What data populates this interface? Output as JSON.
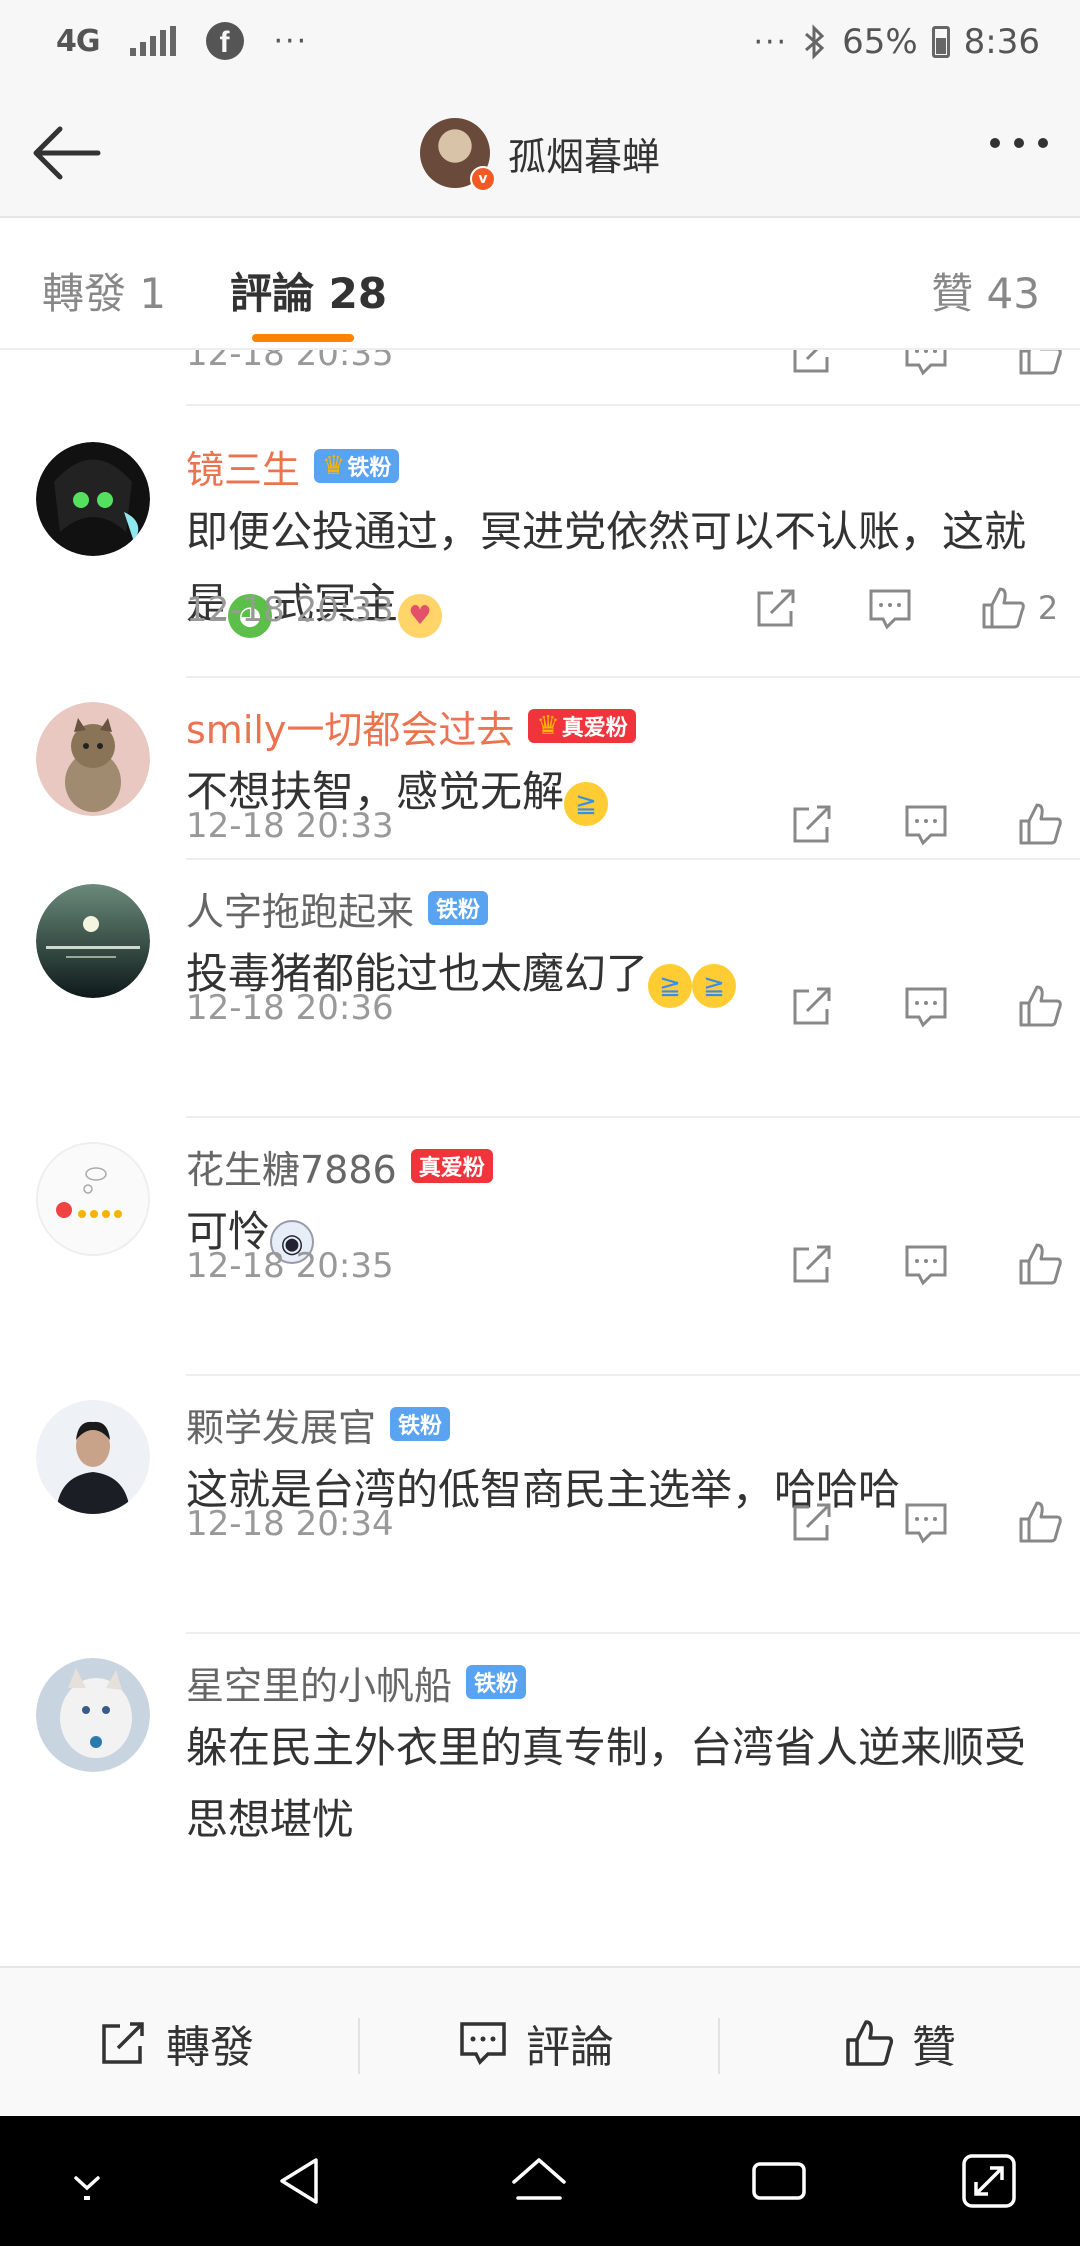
{
  "status_bar": {
    "network": "4G",
    "battery": "65%",
    "time": "8:36",
    "overflow": "···"
  },
  "header": {
    "title": "孤烟暮蝉"
  },
  "tabs": [
    {
      "label": "轉發 1",
      "active": false
    },
    {
      "label": "評論 28",
      "active": true
    },
    {
      "label": "贊 43",
      "active": false
    }
  ],
  "partial_comment": {
    "time": "12-18 20:35"
  },
  "comments": [
    {
      "username": "镜三生",
      "name_color": "orange",
      "badge": "铁粉",
      "badge_color": "blue",
      "crown": true,
      "text_segments": [
        "即便公投通过，冥进党依然可以不认账，这就是",
        "式冥主"
      ],
      "emojis": [
        "frog-emoji",
        "cat-hearts-emoji"
      ],
      "time": "12-18 20:33",
      "likes": "2"
    },
    {
      "username": "smily一切都会过去",
      "name_color": "orange",
      "badge": "真爱粉",
      "badge_color": "red",
      "crown": true,
      "text_segments": [
        "不想扶智，感觉无解"
      ],
      "emojis": [
        "laugh-cry-emoji"
      ],
      "time": "12-18 20:33",
      "likes": ""
    },
    {
      "username": "人字拖跑起来",
      "name_color": "gray",
      "badge": "铁粉",
      "badge_color": "blue",
      "crown": false,
      "text_segments": [
        "投毒猪都能过也太魔幻了"
      ],
      "emojis": [
        "laugh-cry-emoji",
        "laugh-cry-emoji"
      ],
      "time": "12-18 20:36",
      "likes": ""
    },
    {
      "username": "花生糖7886",
      "name_color": "gray",
      "badge": "真爱粉",
      "badge_color": "red",
      "crown": false,
      "text_segments": [
        "可怜"
      ],
      "emojis": [
        "panda-emoji"
      ],
      "time": "12-18 20:35",
      "likes": ""
    },
    {
      "username": "颗学发展官",
      "name_color": "gray",
      "badge": "铁粉",
      "badge_color": "blue",
      "crown": false,
      "text_segments": [
        "这就是台湾的低智商民主选举，哈哈哈"
      ],
      "emojis": [],
      "time": "12-18 20:34",
      "likes": ""
    },
    {
      "username": "星空里的小帆船",
      "name_color": "gray",
      "badge": "铁粉",
      "badge_color": "blue",
      "crown": false,
      "text_segments": [
        "躲在民主外衣里的真专制，台湾省人逆来顺受思想堪忧"
      ],
      "emojis": [],
      "time": "",
      "likes": ""
    }
  ],
  "bottom_bar": {
    "repost": "轉發",
    "comment": "評論",
    "like": "贊"
  },
  "colors": {
    "accent": "#ff8200",
    "name_orange": "#eb7350",
    "badge_blue": "#5aa3f0",
    "badge_red": "#f0343c"
  }
}
